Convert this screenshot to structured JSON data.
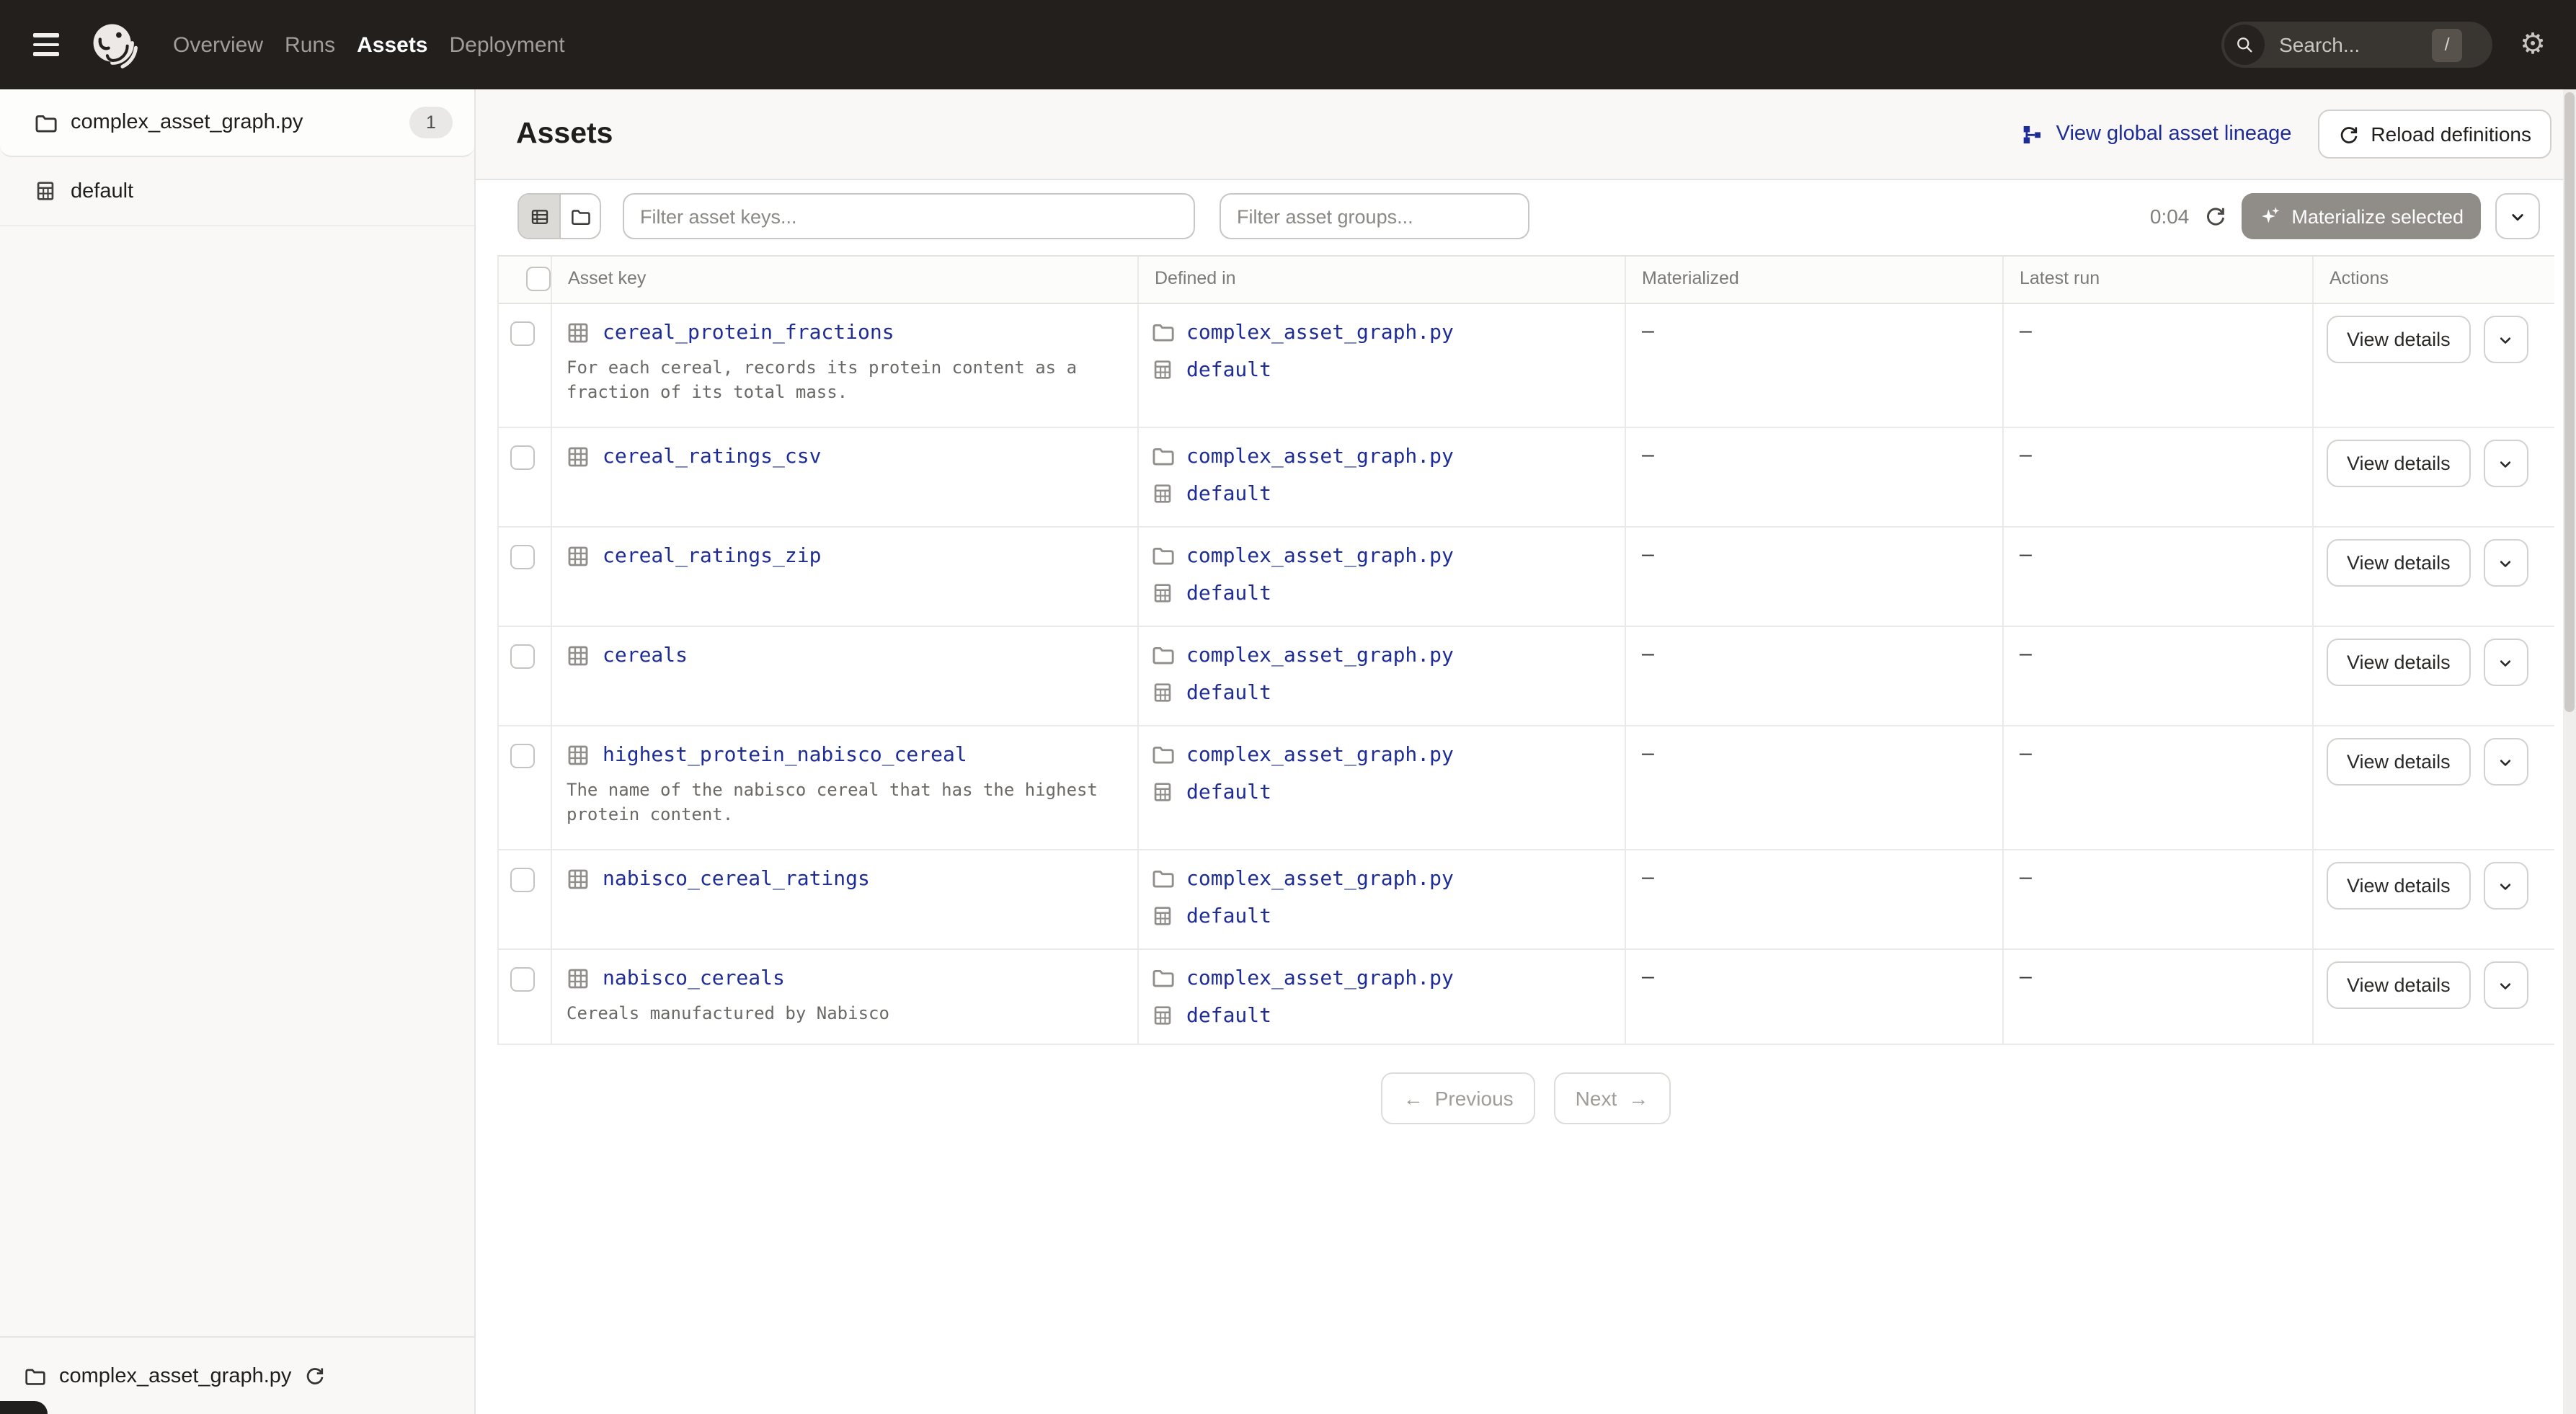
{
  "topnav": {
    "links": [
      {
        "label": "Overview",
        "active": false
      },
      {
        "label": "Runs",
        "active": false
      },
      {
        "label": "Assets",
        "active": true
      },
      {
        "label": "Deployment",
        "active": false
      }
    ],
    "search": {
      "placeholder": "Search...",
      "shortcut": "/"
    }
  },
  "sidebar": {
    "repo": {
      "name": "complex_asset_graph.py",
      "badge": "1"
    },
    "group": {
      "name": "default"
    },
    "footer": {
      "name": "complex_asset_graph.py"
    }
  },
  "header": {
    "title": "Assets",
    "lineage_link": "View global asset lineage",
    "reload_button": "Reload definitions"
  },
  "toolbar": {
    "filter_keys_placeholder": "Filter asset keys...",
    "filter_groups_placeholder": "Filter asset groups...",
    "timer": "0:04",
    "materialize_label": "Materialize selected"
  },
  "table": {
    "columns": [
      "Asset key",
      "Defined in",
      "Materialized",
      "Latest run",
      "Actions"
    ],
    "view_details_label": "View details",
    "rows": [
      {
        "key": "cereal_protein_fractions",
        "description": "For each cereal, records its protein content as a fraction of its total mass.",
        "file": "complex_asset_graph.py",
        "group": "default",
        "materialized": "–",
        "latest_run": "–"
      },
      {
        "key": "cereal_ratings_csv",
        "description": "",
        "file": "complex_asset_graph.py",
        "group": "default",
        "materialized": "–",
        "latest_run": "–"
      },
      {
        "key": "cereal_ratings_zip",
        "description": "",
        "file": "complex_asset_graph.py",
        "group": "default",
        "materialized": "–",
        "latest_run": "–"
      },
      {
        "key": "cereals",
        "description": "",
        "file": "complex_asset_graph.py",
        "group": "default",
        "materialized": "–",
        "latest_run": "–"
      },
      {
        "key": "highest_protein_nabisco_cereal",
        "description": "The name of the nabisco cereal that has the highest protein content.",
        "file": "complex_asset_graph.py",
        "group": "default",
        "materialized": "–",
        "latest_run": "–"
      },
      {
        "key": "nabisco_cereal_ratings",
        "description": "",
        "file": "complex_asset_graph.py",
        "group": "default",
        "materialized": "–",
        "latest_run": "–"
      },
      {
        "key": "nabisco_cereals",
        "description": "Cereals manufactured by Nabisco",
        "file": "complex_asset_graph.py",
        "group": "default",
        "materialized": "–",
        "latest_run": "–"
      }
    ]
  },
  "pagination": {
    "previous": "Previous",
    "previous_arrow": "←",
    "next": "Next",
    "next_arrow": "→"
  },
  "colors": {
    "nav_bg": "#221f1d",
    "link": "#1e2c97",
    "materialize_disabled_bg": "#908d88",
    "sidebar_bg": "#f9f8f7"
  }
}
